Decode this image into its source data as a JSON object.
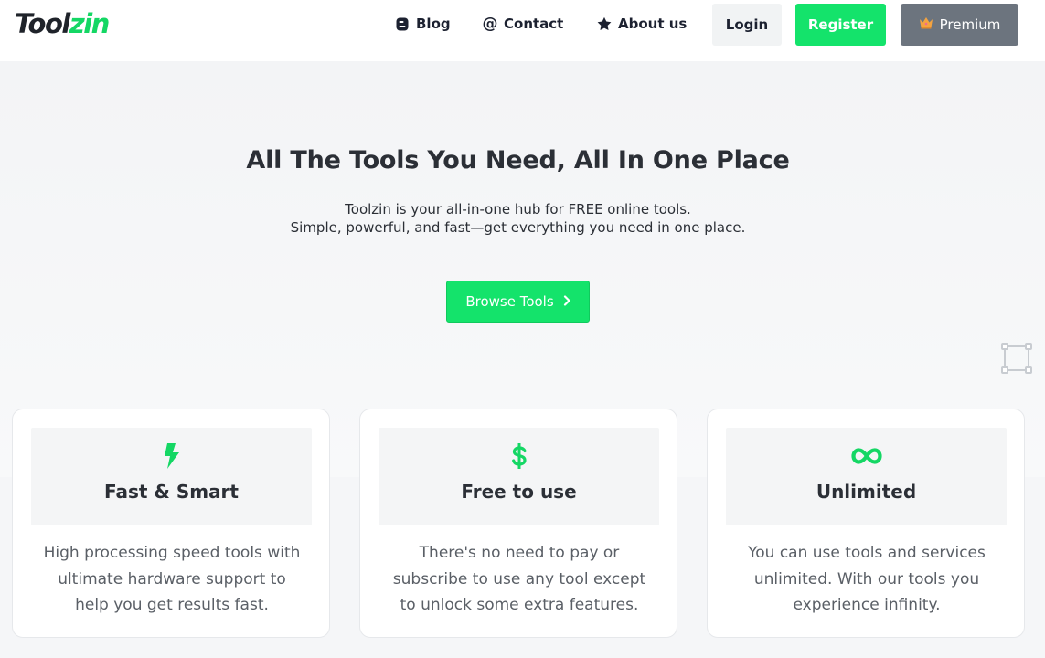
{
  "header": {
    "logo_part1": "Tool",
    "logo_part2": "zin",
    "nav": [
      {
        "label": "Blog",
        "icon": "blog-icon"
      },
      {
        "label": "Contact",
        "icon": "at-icon"
      },
      {
        "label": "About us",
        "icon": "star-icon"
      }
    ],
    "login_label": "Login",
    "register_label": "Register",
    "premium_label": "Premium",
    "premium_icon": "crown-icon"
  },
  "hero": {
    "title": "All The Tools You Need, All In One Place",
    "subtitle_line1": "Toolzin is your all-in-one hub for FREE online tools.",
    "subtitle_line2": "Simple, powerful, and fast—get everything you need in one place.",
    "browse_label": "Browse Tools",
    "browse_icon": "chevron-right-icon"
  },
  "features": [
    {
      "icon": "lightning-icon",
      "title": "Fast & Smart",
      "desc_lines": [
        "High processing speed tools with",
        "ultimate hardware support to",
        "help you get results fast."
      ]
    },
    {
      "icon": "dollar-icon",
      "title": "Free to use",
      "desc_lines": [
        "There's no need to pay or",
        "subscribe to use any tool except",
        "to unlock some extra features."
      ]
    },
    {
      "icon": "infinity-icon",
      "title": "Unlimited",
      "desc_lines": [
        "You can use tools and services",
        "unlimited. With our tools you",
        "experience infinity."
      ]
    }
  ],
  "colors": {
    "accent": "#14e36b",
    "text_dark": "#2b2f36",
    "premium_bg": "#6c747e"
  }
}
